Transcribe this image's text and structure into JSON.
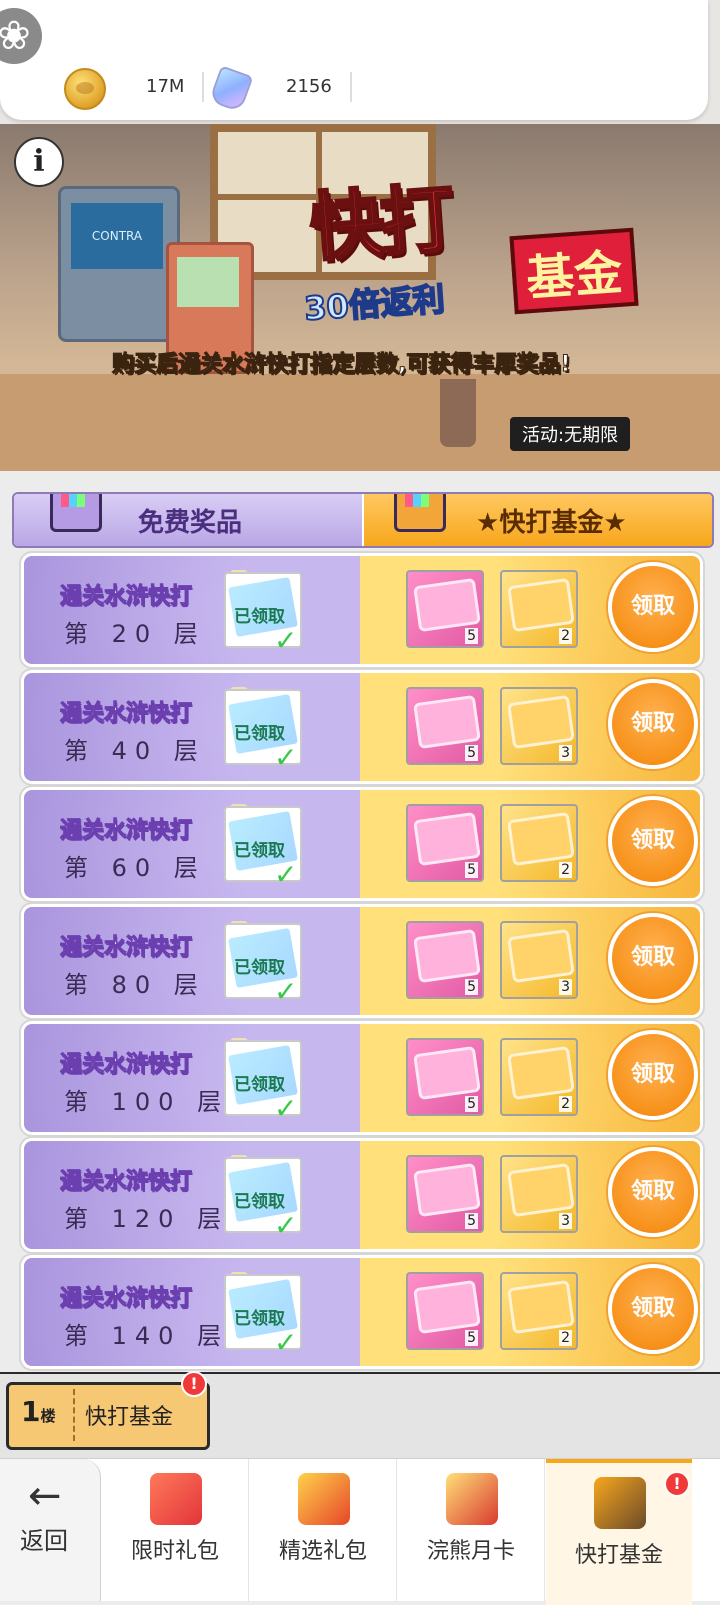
{
  "header": {
    "coins": "17M",
    "gems": "2156"
  },
  "banner": {
    "title_main": "快打",
    "title_fund": "基金",
    "subtitle": "30倍返利",
    "desc_before": "购买后通关",
    "desc_highlight": "水浒快打",
    "desc_after": "指定层数,可获得丰厚奖品!",
    "duration": "活动:无期限",
    "info_glyph": "i"
  },
  "tabs": {
    "free": "免费奖品",
    "fund": "快打基金",
    "star": "★"
  },
  "rows": [
    {
      "title": "通关水浒快打",
      "floor": "第 20 层",
      "claimed": "已领取",
      "check": "✓",
      "qty1": "5",
      "qty2": "2",
      "btn": "领取"
    },
    {
      "title": "通关水浒快打",
      "floor": "第 40 层",
      "claimed": "已领取",
      "check": "✓",
      "qty1": "5",
      "qty2": "3",
      "btn": "领取"
    },
    {
      "title": "通关水浒快打",
      "floor": "第 60 层",
      "claimed": "已领取",
      "check": "✓",
      "qty1": "5",
      "qty2": "2",
      "btn": "领取"
    },
    {
      "title": "通关水浒快打",
      "floor": "第 80 层",
      "claimed": "已领取",
      "check": "✓",
      "qty1": "5",
      "qty2": "3",
      "btn": "领取"
    },
    {
      "title": "通关水浒快打",
      "floor": "第 100 层",
      "claimed": "已领取",
      "check": "✓",
      "qty1": "5",
      "qty2": "2",
      "btn": "领取"
    },
    {
      "title": "通关水浒快打",
      "floor": "第 120 层",
      "claimed": "已领取",
      "check": "✓",
      "qty1": "5",
      "qty2": "3",
      "btn": "领取"
    },
    {
      "title": "通关水浒快打",
      "floor": "第 140 层",
      "claimed": "已领取",
      "check": "✓",
      "qty1": "5",
      "qty2": "2",
      "btn": "领取"
    }
  ],
  "floor_tag": {
    "num": "1",
    "unit": "楼",
    "label": "快打基金",
    "badge": "!"
  },
  "tabbar": {
    "back_arrow": "←",
    "back": "返回",
    "items": [
      {
        "label": "限时礼包"
      },
      {
        "label": "精选礼包"
      },
      {
        "label": "浣熊月卡"
      },
      {
        "label": "快打基金",
        "badge": "!"
      }
    ]
  },
  "icons": {
    "menu": "menu-flower-icon",
    "coin": "coin-icon",
    "gem": "gem-icon"
  }
}
